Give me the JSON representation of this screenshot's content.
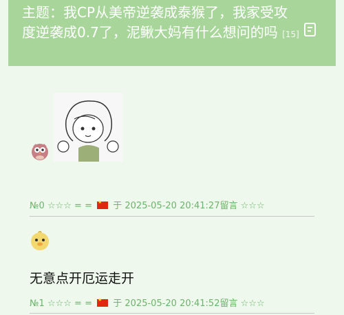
{
  "topic": {
    "title": "主题：我CP从美帝逆袭成泰猴了，我家受攻度逆袭成0.7了，泥鳅大妈有什么想问的吗",
    "reply_count": "[15]",
    "icon": "reply-icon"
  },
  "posts": [
    {
      "number": "№0",
      "stars_left": "☆☆☆",
      "eq": "= =",
      "flag_icon": "china-flag-icon",
      "at": "于",
      "timestamp": "2025-05-20 20:41:27",
      "action": "留言",
      "stars_right": "☆☆☆",
      "avatar_icon": "owl-avatar-icon",
      "image": "sketch-girl-image",
      "content": ""
    },
    {
      "number": "№1",
      "stars_left": "☆☆☆",
      "eq": "= =",
      "flag_icon": "china-flag-icon",
      "at": "于",
      "timestamp": "2025-05-20 20:41:52",
      "action": "留言",
      "stars_right": "☆☆☆",
      "avatar_icon": "chick-avatar-icon",
      "content": "无意点开厄运走开"
    }
  ],
  "colors": {
    "background": "#eef8ec",
    "header": "#a8d69a",
    "meta_text": "#6ab56a"
  }
}
